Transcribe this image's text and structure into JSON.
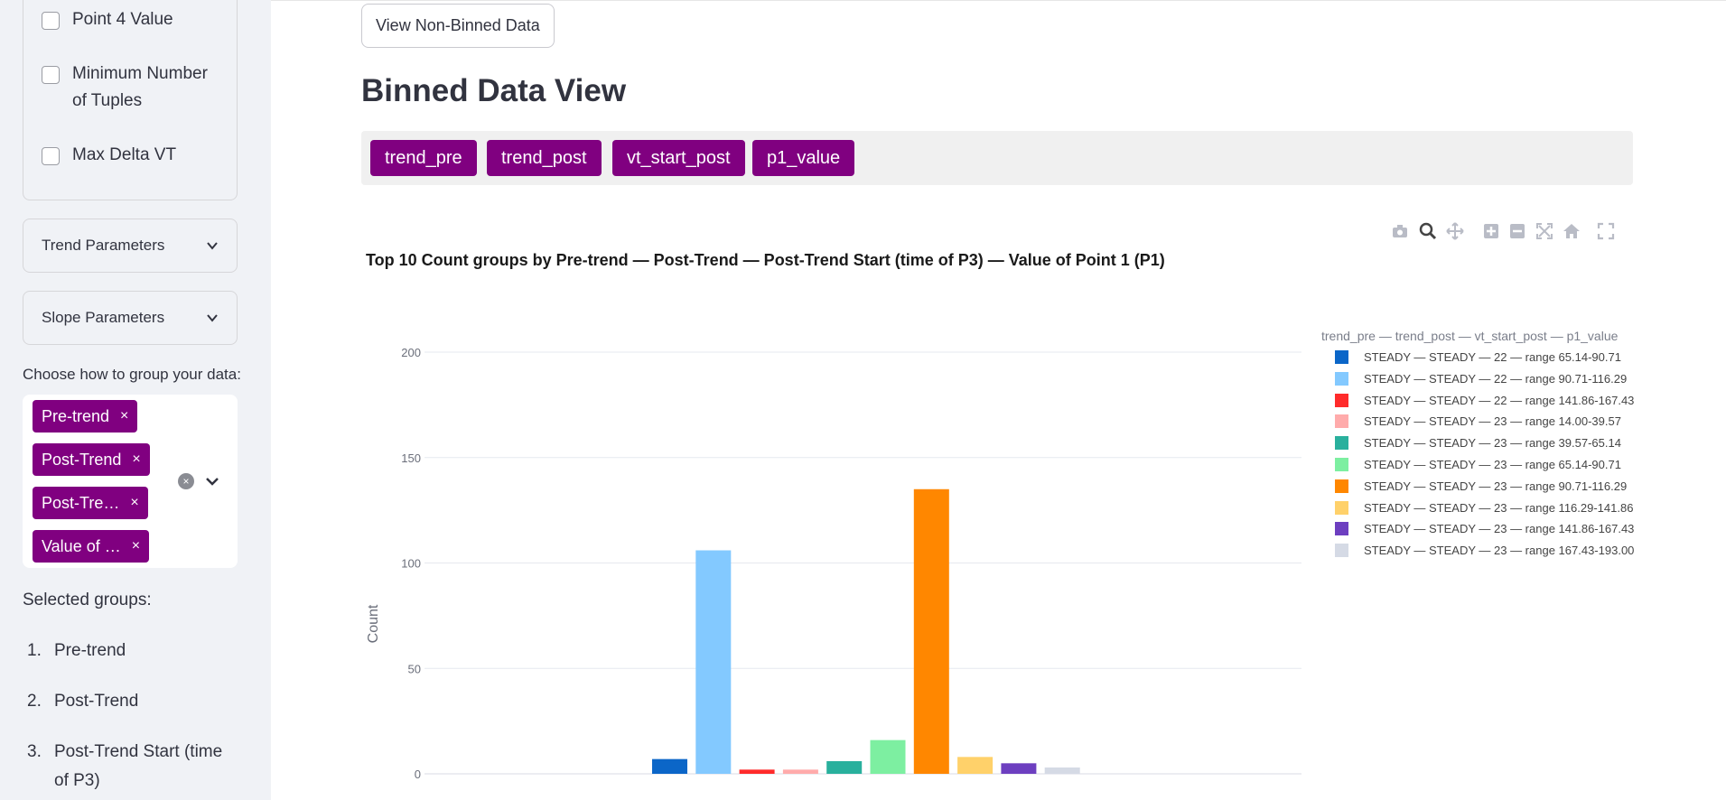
{
  "sidebar": {
    "checkboxes": [
      {
        "label": "Point 4 Value",
        "checked": false
      },
      {
        "label": "Minimum Number of Tuples",
        "checked": false
      },
      {
        "label": "Max Delta VT",
        "checked": false
      }
    ],
    "expanders": [
      {
        "label": "Trend Parameters"
      },
      {
        "label": "Slope Parameters"
      }
    ],
    "group_label": "Choose how to group your data:",
    "chips": [
      {
        "label": "Pre-trend"
      },
      {
        "label": "Post-Trend"
      },
      {
        "label": "Post-Tre…"
      },
      {
        "label": "Value of …"
      }
    ],
    "chip_remove": "×",
    "clear_all": "×",
    "selected_title": "Selected groups:",
    "selected_groups": [
      {
        "num": "1.",
        "label": "Pre-trend"
      },
      {
        "num": "2.",
        "label": "Post-Trend"
      },
      {
        "num": "3.",
        "label": "Post-Trend Start (time of P3)"
      }
    ]
  },
  "main": {
    "non_binned_button": "View Non-Binned Data",
    "heading": "Binned Data View",
    "tags": [
      "trend_pre",
      "trend_post",
      "vt_start_post",
      "p1_value"
    ]
  },
  "chart_data": {
    "type": "bar",
    "title": "Top 10 Count groups by Pre-trend — Post-Trend — Post-Trend Start (time of P3) — Value of Point 1 (P1)",
    "ylabel": "Count",
    "xlabel": "",
    "ylim": [
      0,
      200
    ],
    "yticks": [
      0,
      50,
      100,
      150,
      200
    ],
    "grid": true,
    "legend_title": "trend_pre — trend_post — vt_start_post — p1_value",
    "legend_position": "right",
    "series": [
      {
        "name": "STEADY — STEADY — 22 — range 65.14-90.71",
        "value": 7,
        "color": "#0b66c8"
      },
      {
        "name": "STEADY — STEADY — 22 — range 90.71-116.29",
        "value": 106,
        "color": "#83c9ff"
      },
      {
        "name": "STEADY — STEADY — 22 — range 141.86-167.43",
        "value": 2,
        "color": "#ff2b2b"
      },
      {
        "name": "STEADY — STEADY — 23 — range 14.00-39.57",
        "value": 2,
        "color": "#ffabab"
      },
      {
        "name": "STEADY — STEADY — 23 — range 39.57-65.14",
        "value": 6,
        "color": "#29b09d"
      },
      {
        "name": "STEADY — STEADY — 23 — range 65.14-90.71",
        "value": 16,
        "color": "#7defa1"
      },
      {
        "name": "STEADY — STEADY — 23 — range 90.71-116.29",
        "value": 135,
        "color": "#ff8700"
      },
      {
        "name": "STEADY — STEADY — 23 — range 116.29-141.86",
        "value": 8,
        "color": "#ffd16a"
      },
      {
        "name": "STEADY — STEADY — 23 — range 141.86-167.43",
        "value": 5,
        "color": "#6d3fc0"
      },
      {
        "name": "STEADY — STEADY — 23 — range 167.43-193.00",
        "value": 3,
        "color": "#d5dae5"
      }
    ]
  },
  "modebar": {
    "icons": [
      "camera-icon",
      "zoom-icon",
      "pan-icon",
      "zoom-in-icon",
      "zoom-out-icon",
      "autoscale-icon",
      "reset-axes-icon",
      "fullscreen-icon"
    ]
  }
}
